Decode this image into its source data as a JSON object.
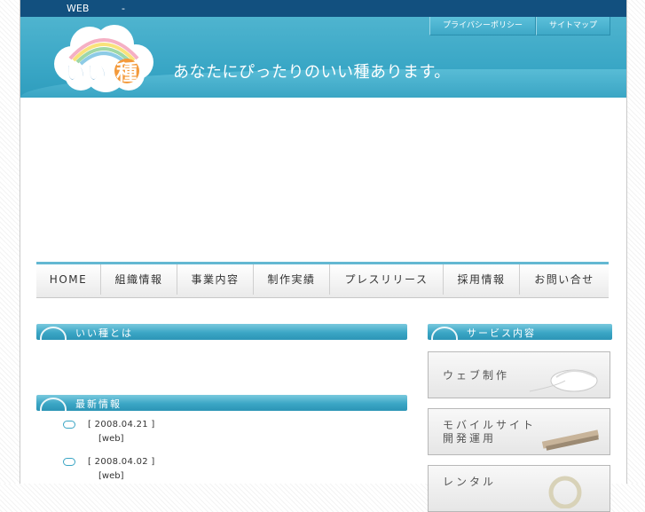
{
  "topbar": {
    "left_text": "WEB",
    "right_text": "-"
  },
  "header": {
    "links": [
      "プライバシーポリシー",
      "サイトマップ"
    ],
    "logo_text": "いい種",
    "tagline": "あなたにぴったりのいい種あります。"
  },
  "nav": {
    "items": [
      {
        "label": "HOME"
      },
      {
        "label": "組織情報"
      },
      {
        "label": "事業内容"
      },
      {
        "label": "制作実績"
      },
      {
        "label": "プレスリリース"
      },
      {
        "label": "採用情報"
      },
      {
        "label": "お問い合せ"
      }
    ]
  },
  "sections": {
    "about_title": "いい種とは",
    "news_title": "最新情報",
    "services_title": "サービス内容"
  },
  "news": [
    {
      "date": "[ 2008.04.21 ]",
      "category": "[web]"
    },
    {
      "date": "[ 2008.04.02 ]",
      "category": "[web]"
    }
  ],
  "services": [
    {
      "line1": "ウェブ制作",
      "line2": ""
    },
    {
      "line1": "モバイルサイト",
      "line2": "開発運用"
    },
    {
      "line1": "レンタル",
      "line2": ""
    }
  ],
  "colors": {
    "topbar": "#12507f",
    "header": "#3aa7c6",
    "accent": "#63b8d2"
  }
}
